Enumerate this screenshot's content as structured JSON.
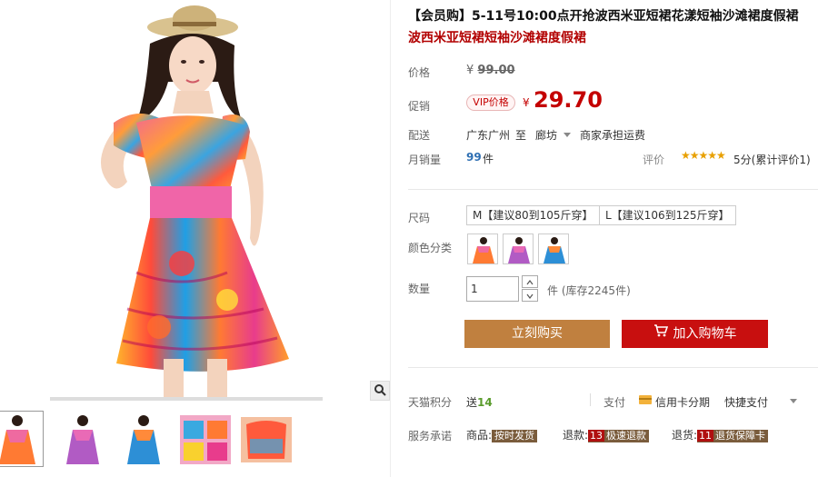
{
  "product": {
    "title": "【会员购】5-11号10:00点开抢波西米亚短裙花漾短袖沙滩裙度假裙",
    "subtitle": "波西米亚短裙短袖沙滩裙度假裙"
  },
  "price": {
    "label": "价格",
    "currency": "¥",
    "original": "99.00",
    "promo_label": "促销",
    "vip_badge": "VIP价格",
    "promo_currency": "¥",
    "promo_price": "29.70"
  },
  "delivery": {
    "label": "配送",
    "from": "广东广州",
    "to_word": "至",
    "destination": "廊坊",
    "shipping": "商家承担运费"
  },
  "sales": {
    "label": "月销量",
    "count": "99",
    "unit": "件",
    "rating_label": "评价",
    "stars": "★★★★★",
    "rating_text": "5分(累计评价1)"
  },
  "size": {
    "label": "尺码",
    "options": [
      "M【建议80到105斤穿】",
      "L【建议106到125斤穿】"
    ]
  },
  "color": {
    "label": "颜色分类"
  },
  "quantity": {
    "label": "数量",
    "value": "1",
    "unit": "件",
    "stock": "(库存2245件)"
  },
  "actions": {
    "buy_now": "立刻购买",
    "add_cart": "加入购物车"
  },
  "footer": {
    "points_label": "天猫积分",
    "points_prefix": "送",
    "points_value": "14",
    "pay_label": "支付",
    "credit_card": "信用卡分期",
    "quick_pay": "快捷支付",
    "service_label": "服务承诺",
    "goods_label": "商品:",
    "goods_badge": "按时发货",
    "refund_label": "退款:",
    "refund_num": "13",
    "refund_badge": "极速退款",
    "return_label": "退货:",
    "return_num": "11",
    "return_badge": "退货保障卡"
  },
  "colors": {
    "accent_red": "#c40000",
    "buy_now_bg": "#c0803f",
    "add_cart_bg": "#c80f0f",
    "stars": "#e8a000",
    "sales_blue": "#2e6fb3"
  }
}
